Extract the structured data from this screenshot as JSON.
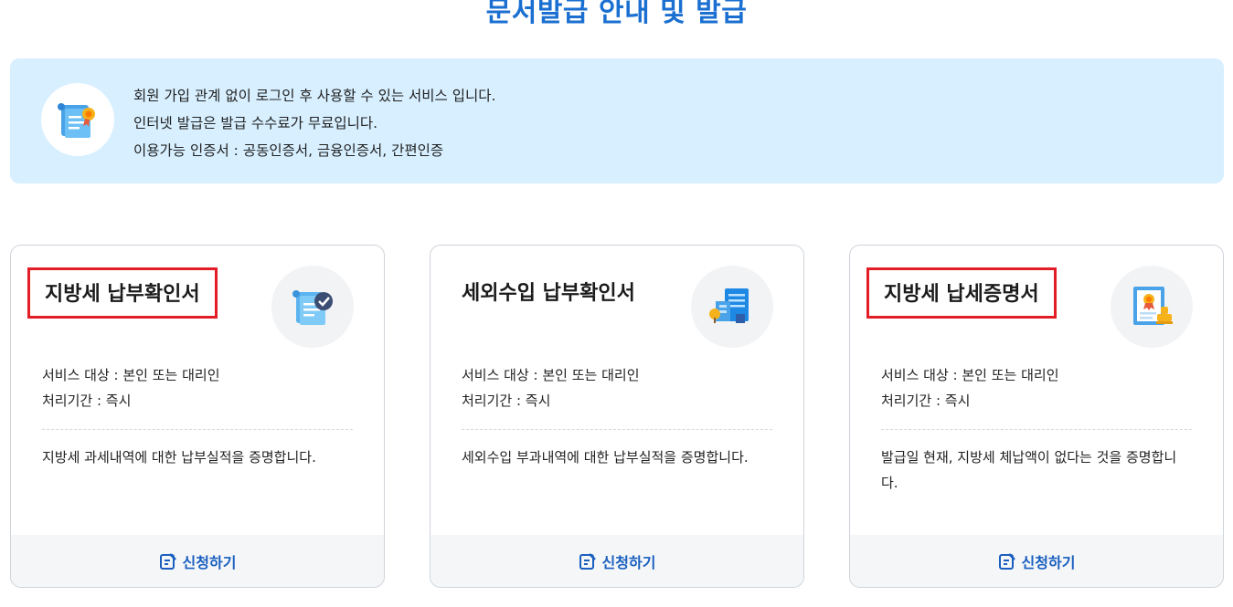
{
  "page": {
    "title": "문서발급 안내 및 발급"
  },
  "info": {
    "icon": "scroll-certificate-icon",
    "lines": [
      "회원 가입 관계 없이 로그인 후 사용할 수 있는 서비스 입니다.",
      "인터넷 발급은 발급 수수료가 무료입니다.",
      "이용가능 인증서 : 공동인증서, 금융인증서, 간편인증"
    ]
  },
  "cards": [
    {
      "title": "지방세 납부확인서",
      "icon": "scroll-check-icon",
      "target": "서비스 대상 : 본인 또는 대리인",
      "period": "처리기간 : 즉시",
      "description": "지방세 과세내역에 대한 납부실적을 증명합니다.",
      "apply_label": "신청하기",
      "highlighted": true
    },
    {
      "title": "세외수입 납부확인서",
      "icon": "building-document-icon",
      "target": "서비스 대상 : 본인 또는 대리인",
      "period": "처리기간 : 즉시",
      "description": "세외수입 부과내역에 대한 납부실적을 증명합니다.",
      "apply_label": "신청하기",
      "highlighted": false
    },
    {
      "title": "지방세 납세증명서",
      "icon": "certificate-stamp-icon",
      "target": "서비스 대상 : 본인 또는 대리인",
      "period": "처리기간 : 즉시",
      "description": "발급일 현재, 지방세 체납액이 없다는 것을 증명합니다.",
      "apply_label": "신청하기",
      "highlighted": true
    }
  ],
  "colors": {
    "title": "#1a6fd1",
    "info_bg": "#d7efff",
    "highlight_border": "#e21d25",
    "apply_text": "#1a5fbf",
    "footer_bg": "#f4f6f8"
  }
}
